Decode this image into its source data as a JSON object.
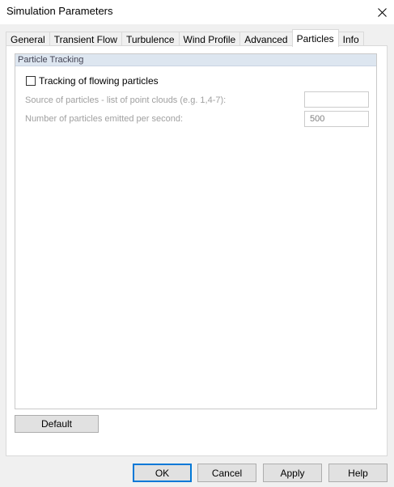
{
  "window": {
    "title": "Simulation Parameters"
  },
  "tabs": [
    {
      "label": "General"
    },
    {
      "label": "Transient Flow"
    },
    {
      "label": "Turbulence"
    },
    {
      "label": "Wind Profile"
    },
    {
      "label": "Advanced"
    },
    {
      "label": "Particles"
    },
    {
      "label": "Info"
    }
  ],
  "active_tab": "Particles",
  "particles": {
    "group_title": "Particle Tracking",
    "tracking_checkbox": {
      "label": "Tracking of flowing particles",
      "checked": false
    },
    "source_field": {
      "label": "Source of particles - list of point clouds (e.g. 1,4-7):",
      "value": ""
    },
    "rate_field": {
      "label": "Number of particles emitted per second:",
      "value": "500"
    },
    "default_label": "Default"
  },
  "footer": {
    "ok_label": "OK",
    "cancel_label": "Cancel",
    "apply_label": "Apply",
    "help_label": "Help"
  }
}
